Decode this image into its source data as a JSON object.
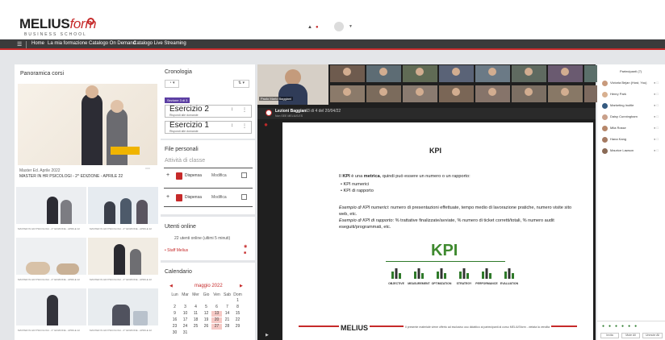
{
  "brand": {
    "logo_main": "MELIUS",
    "logo_accent": "form",
    "logo_sub": "BUSINESS SCHOOL",
    "accent": "#c62a2a"
  },
  "nav": {
    "items": [
      "Home",
      "La mia formazione",
      "Catalogo On Demand",
      "Catalogo Live Streaming"
    ]
  },
  "courses": {
    "title": "Panoramica corsi",
    "hero_badge": "",
    "featured_meta": "Master Ed. Aprile 2022",
    "featured_title": "MASTER IN HR PSICOLOGI - 2^ EDIZIONE - APRILE 22",
    "thumbs": [
      {
        "meta": "MASTER IN HR PSICOLOGI - 2^ EDIZIONE - APRILE 22"
      },
      {
        "meta": "MASTER IN HR PSICOLOGI - 2^ EDIZIONE - APRILE 22"
      },
      {
        "meta": "MASTER IN HR PSICOLOGI - 2^ EDIZIONE - APRILE 22"
      },
      {
        "meta": "MASTER IN HR PSICOLOGI - 2^ EDIZIONE - APRILE 22"
      },
      {
        "meta": "MASTER IN HR PSICOLOGI - 2^ EDIZIONE - APRILE 22"
      },
      {
        "meta": "MASTER IN HR PSICOLOGI - 2^ EDIZIONE - APRILE 22"
      }
    ]
  },
  "timeline": {
    "title": "Cronologia",
    "badge": "Sezione 3 di 3",
    "items": [
      {
        "title": "Esercizio 2",
        "sub": "Rispondi alle domande"
      },
      {
        "title": "Esercizio 1",
        "sub": "Rispondi alle domande"
      }
    ]
  },
  "files": {
    "title": "File personali",
    "subtitle": "Attività di classe",
    "rows": [
      {
        "name": "Dispensa",
        "action": "Modifica"
      },
      {
        "name": "Dispensa",
        "action": "Modifica"
      }
    ]
  },
  "online": {
    "title": "Utenti online",
    "summary": "22 utenti online (ultimi 5 minuti)",
    "user": "Staff Melius"
  },
  "calendar": {
    "title": "Calendario",
    "month": "maggio 2022",
    "weekdays": [
      "Lun",
      "Mar",
      "Mer",
      "Gio",
      "Ven",
      "Sab",
      "Dom"
    ],
    "weeks": [
      [
        "",
        "",
        "",
        "",
        "",
        "",
        "1"
      ],
      [
        "2",
        "3",
        "4",
        "5",
        "6",
        "7",
        "8"
      ],
      [
        "9",
        "10",
        "11",
        "12",
        "13",
        "14",
        "15"
      ],
      [
        "16",
        "17",
        "18",
        "19",
        "20",
        "21",
        "22"
      ],
      [
        "23",
        "24",
        "25",
        "26",
        "27",
        "28",
        "29"
      ],
      [
        "30",
        "31",
        "",
        "",
        "",
        "",
        ""
      ]
    ],
    "highlighted": [
      "13",
      "20",
      "27"
    ]
  },
  "meeting": {
    "speaker": "Paolo Mario Baggiani",
    "presentation_title": "Lezioni Baggiani",
    "presentation_info": "3 di 4 del 20/04/22",
    "presentation_sub": "Non SEE MELIUS.ES",
    "participants_title": "Partecipanti (7)",
    "participants": [
      {
        "name": "Victoria Bejan (Host, You)",
        "color": "#c89a7c"
      },
      {
        "name": "Henry Park",
        "color": "#d8b090"
      },
      {
        "name": "Marketing Inoltle",
        "color": "#355a80"
      },
      {
        "name": "Daisy Cunningham",
        "color": "#c9a08a"
      },
      {
        "name": "Mila Rosse",
        "color": "#b6876a"
      },
      {
        "name": "Hana Kang",
        "color": "#a57a62"
      },
      {
        "name": "Maurice Lawson",
        "color": "#8a6a56"
      }
    ],
    "toolbar": [
      {
        "label": "Invita"
      },
      {
        "label": "Mute All"
      },
      {
        "label": "Unmute All"
      }
    ],
    "tile_colors": [
      "#6e5b4e",
      "#8b7a6a",
      "#5d6c74",
      "#7b6b5c",
      "#606b55",
      "#8a7b70",
      "#5a6377",
      "#7a6656",
      "#6b7a86",
      "#86746a",
      "#5f6a60",
      "#7c6f63",
      "#6a5a70",
      "#887866",
      "#5b6f6a",
      "#7d6a5f",
      "#6f7c6a",
      "#8a6e62"
    ]
  },
  "slide": {
    "title": "KPI",
    "intro_pre": "Il ",
    "intro_kpi": "KPI",
    "intro_mid": " è una ",
    "intro_metrica": "metrica",
    "intro_post": ", quindi può essere un numero o un rapporto:",
    "bullets": [
      "KPI numerici",
      "KPI di rapporto"
    ],
    "ex1_label": "Esempio di KPI numerici",
    "ex1_text": ": numero di presentazioni effettuate, tempo medio di lavorazione pratiche, numero visite sito web, etc.",
    "ex2_label": "Esempio di KPI di rapporto",
    "ex2_text": ": % trattative finalizzate/avviate, % numero di ticket corretti/totali, % numero audit eseguiti/programmati, etc.",
    "diagram_title": "KPI",
    "diagram_labels": [
      "OBJECTIVE",
      "MEASUREMENT",
      "OPTIMIZATION",
      "STRATEGY",
      "PERFORMANCE",
      "EVALUATION"
    ],
    "footer_brand": "MELIUS",
    "footer_text": "Il presente materiale viene offerto ad esclusivo uso didattico ai partecipanti al corso MELIUSform - vietata la vendita"
  }
}
